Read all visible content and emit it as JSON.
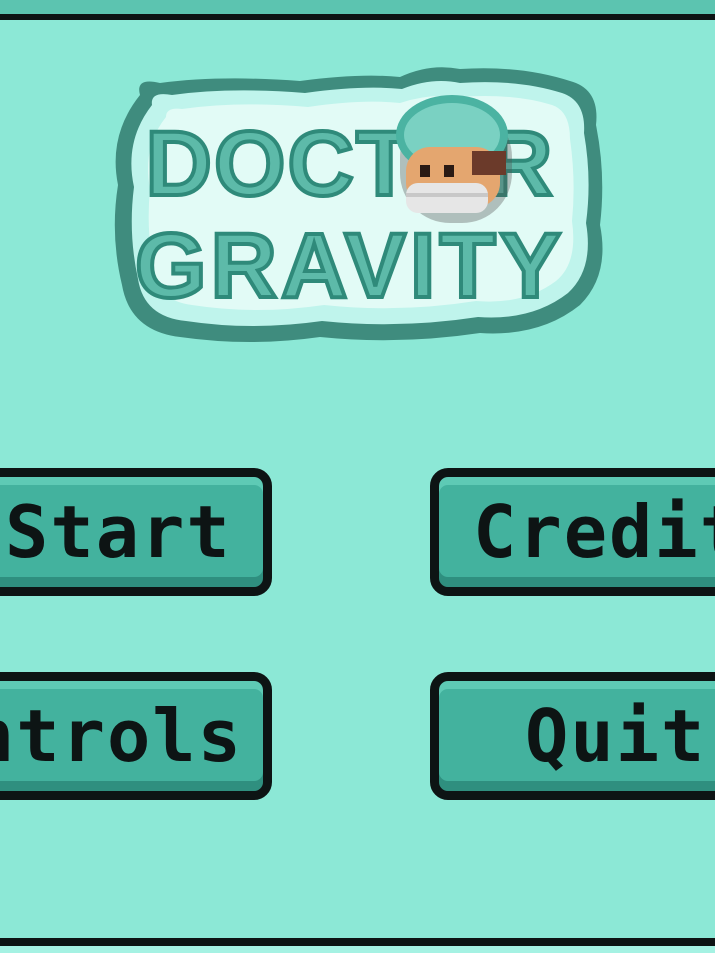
{
  "game": {
    "title_line1": "DOCTOR",
    "title_line2": "GRAVITY"
  },
  "menu": {
    "start": "Start",
    "credits": "Credits",
    "controls": "Controls",
    "quit": "Quit"
  },
  "colors": {
    "background": "#8ce8d6",
    "button_fill": "#43b29e",
    "outline": "#0d1414",
    "logo_letters": "#5dbaa9"
  },
  "icons": {
    "logo_mascot": "doctor-face-icon"
  }
}
